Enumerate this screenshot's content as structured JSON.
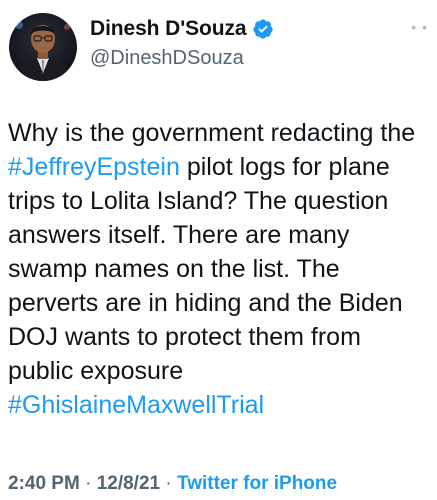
{
  "author": {
    "display_name": "Dinesh D'Souza",
    "handle": "@DineshDSouza",
    "verified_icon": "verified-badge-icon"
  },
  "more_icon": "more-dots-icon",
  "tweet": {
    "part1": "Why is the government redacting the ",
    "hashtag1": "#JeffreyEpstein",
    "part2": " pilot logs for plane trips to Lolita Island? The question answers itself. There are many swamp names on the list. The perverts are in hiding and the Biden DOJ wants to protect them from public exposure\n",
    "hashtag2": "#GhislaineMaxwellTrial"
  },
  "meta": {
    "time": "2:40 PM",
    "sep1": " · ",
    "date": "12/8/21",
    "sep2": " · ",
    "source": "Twitter for iPhone"
  },
  "colors": {
    "link": "#1d9bf0",
    "secondary_text": "#536471",
    "primary_text": "#0f1419"
  }
}
